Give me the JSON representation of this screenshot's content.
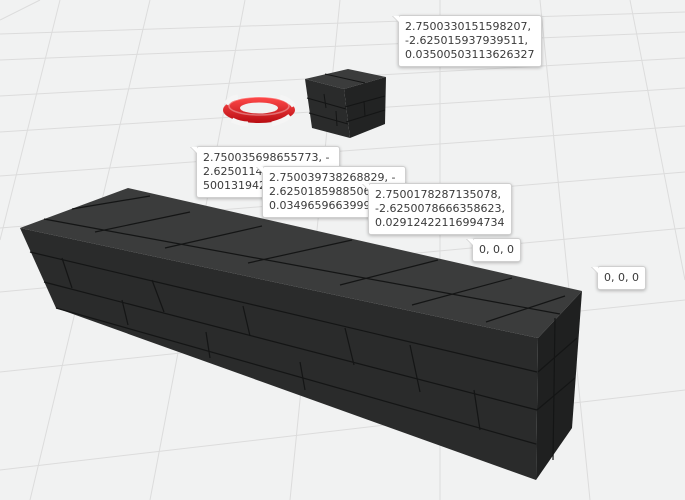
{
  "scene": {
    "colors": {
      "background": "#f1f2f2",
      "grid": "#dcdcdc",
      "block_top": "#3b3c3c",
      "block_front": "#2a2b2b",
      "block_side": "#222323",
      "seam": "#141515",
      "ring_red": "#e2161d",
      "ring_white": "#f5f5f5"
    },
    "objects": [
      {
        "kind": "wall",
        "name": "long-stone-block"
      },
      {
        "kind": "cube",
        "name": "small-stone-cube"
      },
      {
        "kind": "ring",
        "name": "life-ring"
      }
    ]
  },
  "labels": {
    "cube_position": "2.7500330151598207, -2.625015937939511, 0.03500503113626327",
    "position_a": "2.750035698655773, -2.625011485025, 0.0350013194259",
    "position_b": "2.750039738268829, -2.625018598850633, 0.03496596639999",
    "position_c": "2.7500178287135078, -2.6250078666358623, 0.02912422116994734",
    "position_d": "0, 0, 0",
    "position_e": "0, 0, 0"
  }
}
